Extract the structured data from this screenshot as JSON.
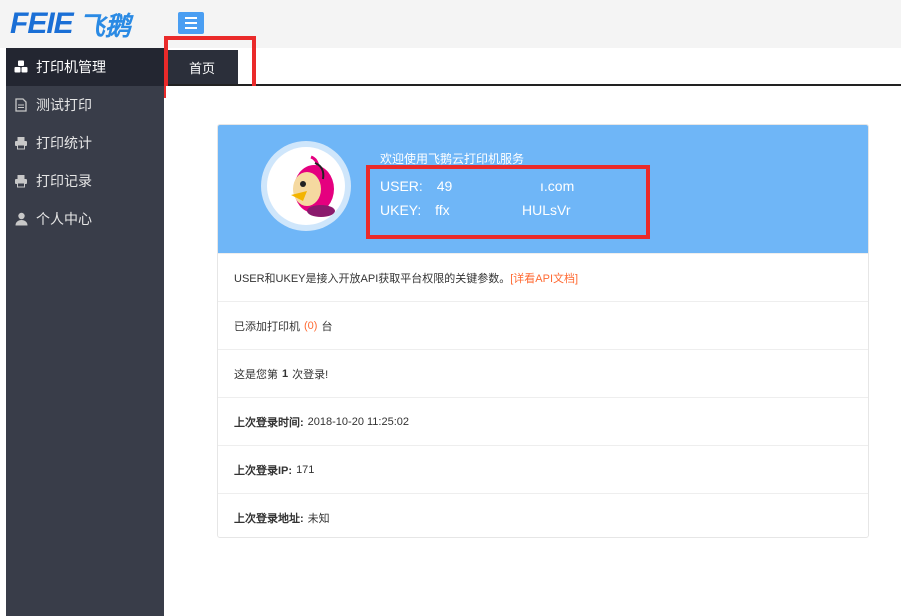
{
  "logo": {
    "brand": "FEIE",
    "name_cn": "飞鹅"
  },
  "sidebar": {
    "items": [
      {
        "label": "打印机管理",
        "icon": "cubes-icon",
        "active": true
      },
      {
        "label": "测试打印",
        "icon": "document-icon",
        "active": false
      },
      {
        "label": "打印统计",
        "icon": "printer-icon",
        "active": false
      },
      {
        "label": "打印记录",
        "icon": "printer-icon",
        "active": false
      },
      {
        "label": "个人中心",
        "icon": "user-icon",
        "active": false
      }
    ]
  },
  "tabs": [
    {
      "label": "首页",
      "active": true
    }
  ],
  "card": {
    "welcome": "欢迎使用飞鹅云打印机服务",
    "user_label": "USER:",
    "user_value": "49",
    "user_value2": "ı.com",
    "ukey_label": "UKEY:",
    "ukey_value": "ffx",
    "ukey_value2": "HULsVr",
    "info_text": "USER和UKEY是接入开放API获取平台权限的关键参数。",
    "info_link": "[详看API文档]",
    "printers_prefix": "已添加打印机",
    "printers_count": "(0)",
    "printers_suffix": "台",
    "login_prefix": "这是您第",
    "login_count": "1",
    "login_suffix": "次登录!",
    "last_time_label": "上次登录时间:",
    "last_time_value": "2018-10-20 11:25:02",
    "last_ip_label": "上次登录IP:",
    "last_ip_value": "171",
    "last_addr_label": "上次登录地址:",
    "last_addr_value": "未知"
  },
  "colors": {
    "sidebar_bg": "#393d49",
    "card_header": "#6fb6f7",
    "highlight": "#ea2a2a",
    "accent": "#ff6a33"
  }
}
